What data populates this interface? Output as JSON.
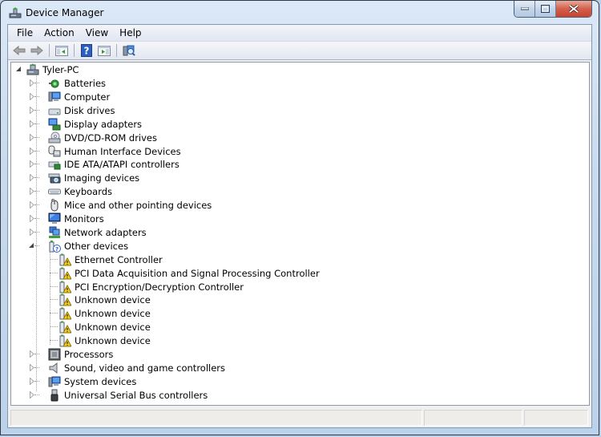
{
  "window": {
    "title": "Device Manager",
    "caption_buttons": {
      "minimize": "minimize",
      "maximize": "maximize",
      "close": "close"
    }
  },
  "menubar": {
    "items": [
      {
        "label": "File"
      },
      {
        "label": "Action"
      },
      {
        "label": "View"
      },
      {
        "label": "Help"
      }
    ]
  },
  "toolbar": {
    "buttons": [
      {
        "icon": "back-arrow-icon",
        "name": "back-button",
        "enabled": false
      },
      {
        "icon": "forward-arrow-icon",
        "name": "forward-button",
        "enabled": false
      },
      {
        "icon": "show-hide-console-tree-icon",
        "name": "show-hide-console-tree-button"
      },
      {
        "icon": "help-icon",
        "name": "help-button"
      },
      {
        "icon": "show-hide-action-pane-icon",
        "name": "show-hide-action-pane-button"
      },
      {
        "icon": "scan-hardware-changes-icon",
        "name": "scan-hardware-button"
      }
    ]
  },
  "tree": {
    "root": {
      "label": "Tyler-PC",
      "icon": "computer-tower-icon",
      "expanded": true
    },
    "categories": [
      {
        "label": "Batteries",
        "icon": "battery-icon",
        "expanded": false
      },
      {
        "label": "Computer",
        "icon": "computer-icon",
        "expanded": false
      },
      {
        "label": "Disk drives",
        "icon": "disk-drive-icon",
        "expanded": false
      },
      {
        "label": "Display adapters",
        "icon": "display-adapter-icon",
        "expanded": false
      },
      {
        "label": "DVD/CD-ROM drives",
        "icon": "dvd-drive-icon",
        "expanded": false
      },
      {
        "label": "Human Interface Devices",
        "icon": "hid-icon",
        "expanded": false
      },
      {
        "label": "IDE ATA/ATAPI controllers",
        "icon": "ide-controller-icon",
        "expanded": false
      },
      {
        "label": "Imaging devices",
        "icon": "imaging-device-icon",
        "expanded": false
      },
      {
        "label": "Keyboards",
        "icon": "keyboard-icon",
        "expanded": false
      },
      {
        "label": "Mice and other pointing devices",
        "icon": "mouse-icon",
        "expanded": false
      },
      {
        "label": "Monitors",
        "icon": "monitor-icon",
        "expanded": false
      },
      {
        "label": "Network adapters",
        "icon": "network-adapter-icon",
        "expanded": false
      },
      {
        "label": "Other devices",
        "icon": "unknown-device-icon",
        "expanded": true,
        "children": [
          {
            "label": "Ethernet Controller",
            "icon": "warning-device-icon"
          },
          {
            "label": "PCI Data Acquisition and Signal Processing Controller",
            "icon": "warning-device-icon"
          },
          {
            "label": "PCI Encryption/Decryption Controller",
            "icon": "warning-device-icon"
          },
          {
            "label": "Unknown device",
            "icon": "warning-device-icon"
          },
          {
            "label": "Unknown device",
            "icon": "warning-device-icon"
          },
          {
            "label": "Unknown device",
            "icon": "warning-device-icon"
          },
          {
            "label": "Unknown device",
            "icon": "warning-device-icon"
          }
        ]
      },
      {
        "label": "Processors",
        "icon": "processor-icon",
        "expanded": false
      },
      {
        "label": "Sound, video and game controllers",
        "icon": "speaker-icon",
        "expanded": false
      },
      {
        "label": "System devices",
        "icon": "system-device-icon",
        "expanded": false
      },
      {
        "label": "Universal Serial Bus controllers",
        "icon": "usb-icon",
        "expanded": false
      }
    ]
  },
  "statusbar": {
    "panes": [
      "",
      "",
      ""
    ]
  }
}
